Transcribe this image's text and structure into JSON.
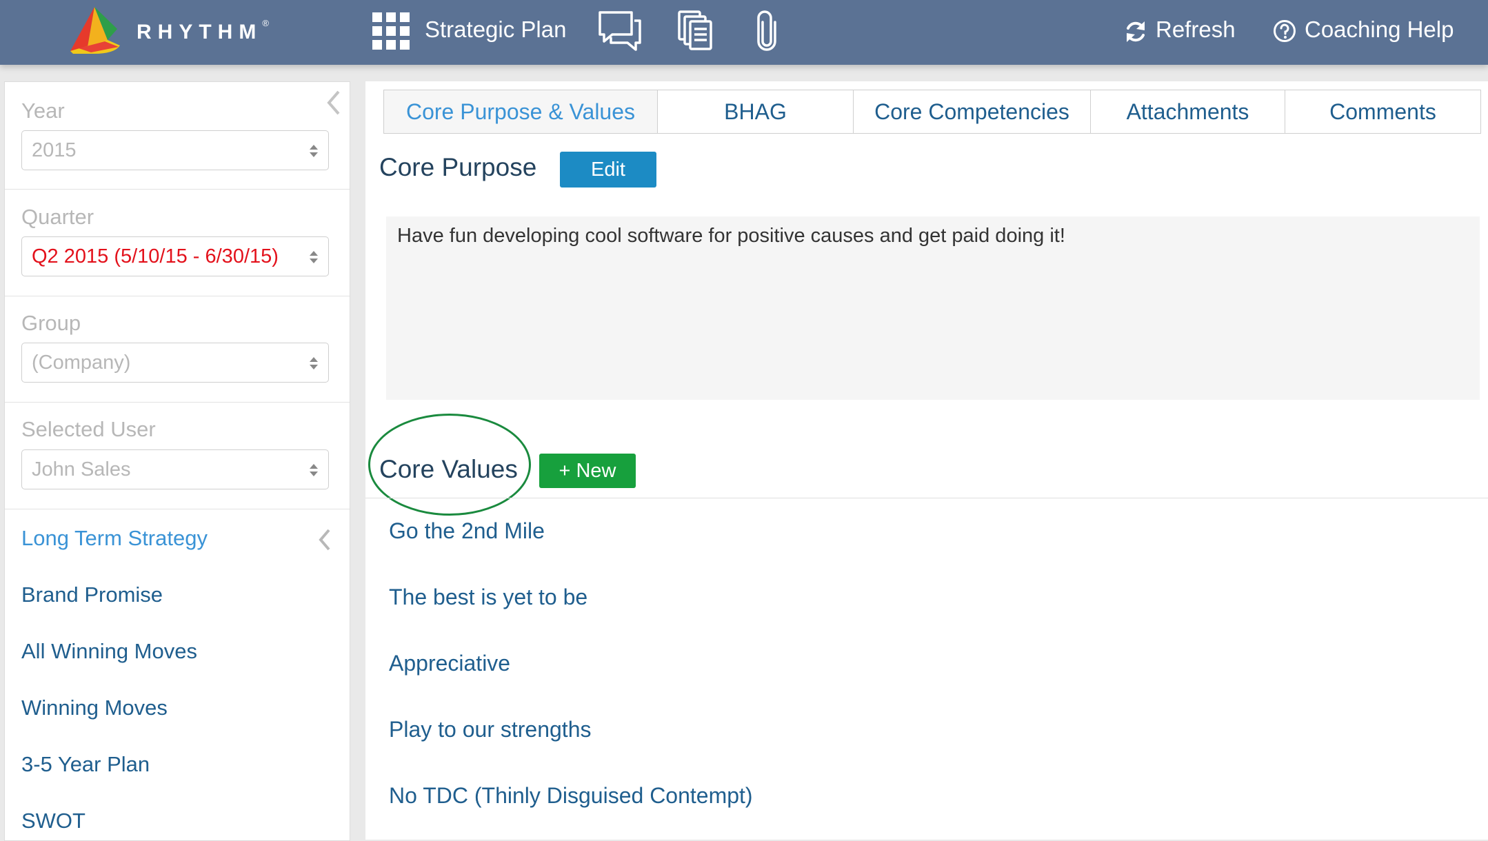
{
  "colors": {
    "topbar": "#5b7294",
    "link": "#1f5e8e",
    "active_link": "#3a93d6",
    "edit_button": "#1c8bc4",
    "new_button": "#17a03d",
    "quarter_text": "#e3111b",
    "highlight_circle": "#1a8a3e"
  },
  "topbar": {
    "brand": "RHYTHM",
    "brand_mark": "®",
    "module": "Strategic Plan",
    "icons": [
      "apps-grid-icon",
      "comments-icon",
      "documents-icon",
      "attachment-icon"
    ],
    "refresh": "Refresh",
    "coaching_help": "Coaching Help"
  },
  "sidebar": {
    "year": {
      "label": "Year",
      "value": "2015"
    },
    "quarter": {
      "label": "Quarter",
      "value": "Q2 2015 (5/10/15 - 6/30/15)"
    },
    "group": {
      "label": "Group",
      "value": "(Company)"
    },
    "user": {
      "label": "Selected User",
      "value": "John Sales"
    },
    "nav": [
      {
        "label": "Long Term Strategy",
        "active": true
      },
      {
        "label": "Brand Promise"
      },
      {
        "label": "All Winning Moves"
      },
      {
        "label": "Winning Moves"
      },
      {
        "label": "3-5 Year Plan"
      },
      {
        "label": "SWOT"
      }
    ]
  },
  "main": {
    "tabs": [
      {
        "label": "Core Purpose & Values",
        "active": true
      },
      {
        "label": "BHAG"
      },
      {
        "label": "Core Competencies"
      },
      {
        "label": "Attachments"
      },
      {
        "label": "Comments"
      }
    ],
    "core_purpose": {
      "title": "Core Purpose",
      "edit_label": "Edit",
      "text": "Have fun developing cool software for positive causes and get paid doing it!"
    },
    "core_values": {
      "title": "Core Values",
      "new_label": "+ New",
      "items": [
        "Go the 2nd Mile",
        "The best is yet to be",
        "Appreciative",
        "Play to our strengths",
        "No TDC (Thinly Disguised Contempt)"
      ]
    }
  }
}
